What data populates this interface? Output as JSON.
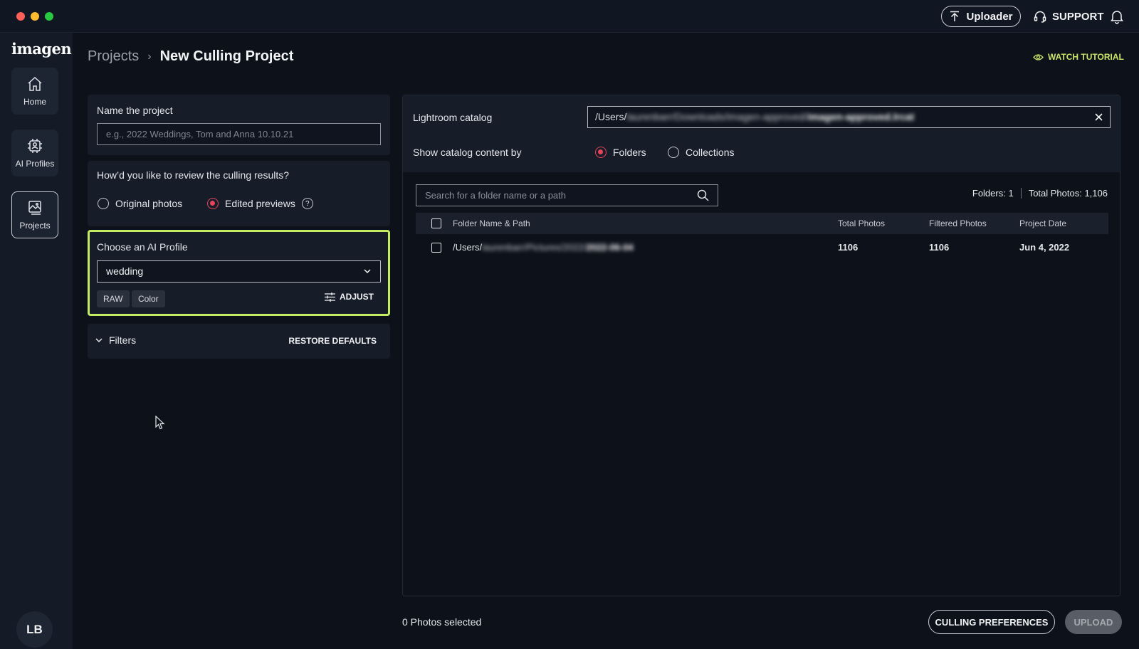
{
  "titlebar": {
    "uploader_label": "Uploader",
    "support_label": "SUPPORT"
  },
  "sidebar": {
    "logo": "imagen",
    "items": [
      {
        "label": "Home",
        "icon": "home-icon"
      },
      {
        "label": "AI Profiles",
        "icon": "ai-chip-icon"
      },
      {
        "label": "Projects",
        "icon": "image-gallery-icon"
      }
    ],
    "avatar_initials": "LB"
  },
  "header": {
    "breadcrumb_root": "Projects",
    "breadcrumb_separator": "›",
    "title": "New Culling Project",
    "watch_tutorial": "WATCH TUTORIAL"
  },
  "project_name": {
    "label": "Name the project",
    "placeholder": "e.g., 2022 Weddings, Tom and Anna 10.10.21",
    "value": ""
  },
  "review": {
    "question": "How’d you like to review the culling results?",
    "options": [
      {
        "label": "Original photos",
        "selected": false
      },
      {
        "label": "Edited previews",
        "selected": true
      }
    ],
    "help": "?"
  },
  "ai_profile": {
    "label": "Choose an AI Profile",
    "selected": "wedding",
    "tags": [
      "RAW",
      "Color"
    ],
    "adjust_label": "ADJUST"
  },
  "filters": {
    "label": "Filters",
    "restore_label": "RESTORE DEFAULTS"
  },
  "catalog": {
    "label": "Lightroom catalog",
    "path_prefix": "/Users/",
    "path_blurred": "laurenbarr/Downloads/imagen-approved/",
    "path_file": "imagen-approved.lrcat",
    "show_label": "Show catalog content by",
    "show_options": [
      {
        "label": "Folders",
        "selected": true
      },
      {
        "label": "Collections",
        "selected": false
      }
    ]
  },
  "folders": {
    "search_placeholder": "Search for a folder name or a path",
    "folders_count": "Folders: 1",
    "total_photos": "Total Photos: 1,106",
    "columns": [
      "Folder Name & Path",
      "Total Photos",
      "Filtered Photos",
      "Project Date"
    ],
    "rows": [
      {
        "path_prefix": "/Users/",
        "path_blurred": "laurenbarr/Pictures/2022/",
        "path_folder": "2022-06-04",
        "total": "1106",
        "filtered": "1106",
        "date": "Jun 4, 2022"
      }
    ]
  },
  "footer": {
    "selected_text": "0 Photos selected",
    "preferences_label": "CULLING PREFERENCES",
    "upload_label": "UPLOAD"
  },
  "colors": {
    "accent_radio": "#e8445a",
    "highlight_border": "#c4ec63",
    "watch_tutorial": "#cde46a"
  }
}
